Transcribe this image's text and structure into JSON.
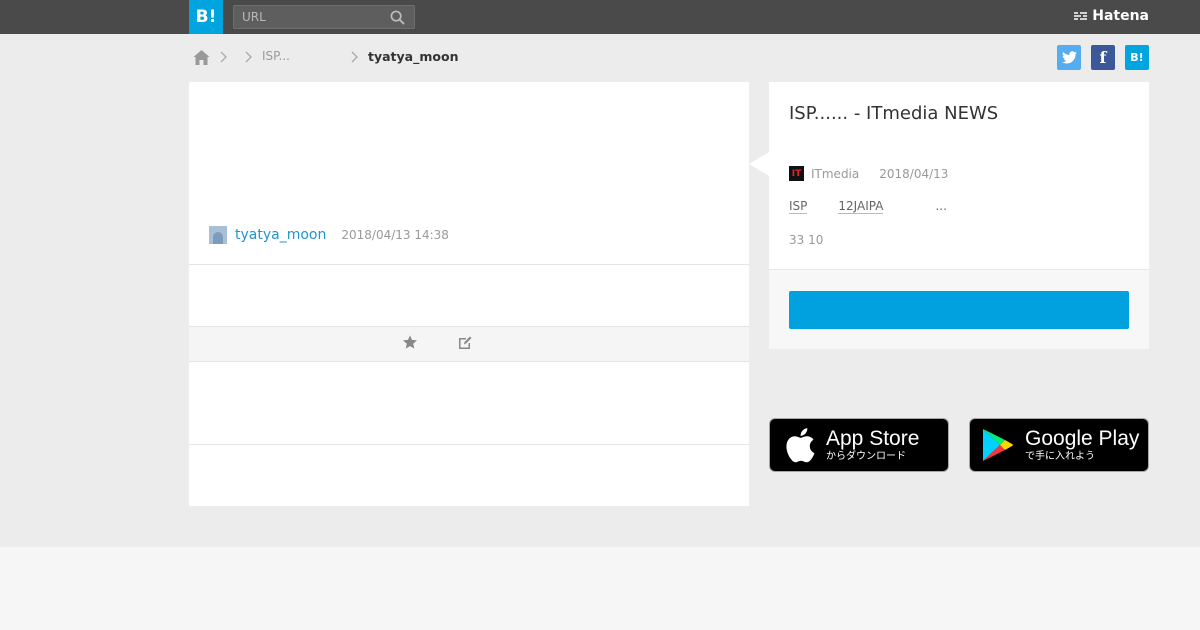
{
  "header": {
    "logo_text": "B!",
    "search_placeholder": "URL",
    "brand": "Hatena"
  },
  "breadcrumb": {
    "item_1": "ISP...",
    "current": "tyatya_moon"
  },
  "share": {
    "facebook_glyph": "f",
    "hatena_glyph": "B!"
  },
  "comment": {
    "username": "tyatya_moon",
    "timestamp": "2018/04/13 14:38"
  },
  "entry": {
    "title": "ISP...... - ITmedia NEWS",
    "favicon_text": "IT",
    "site": "ITmedia",
    "date": "2018/04/13",
    "tags": [
      "ISP",
      "12JAIPA",
      "..."
    ],
    "counts": "33 10"
  },
  "store": {
    "app_store_title": "App Store",
    "app_store_sub": "からダウンロード",
    "google_play_title": "Google Play",
    "google_play_sub": "で手に入れよう"
  },
  "colors": {
    "accent": "#00a4de",
    "link": "#1f95d1",
    "topbar": "#4a4a4a"
  }
}
